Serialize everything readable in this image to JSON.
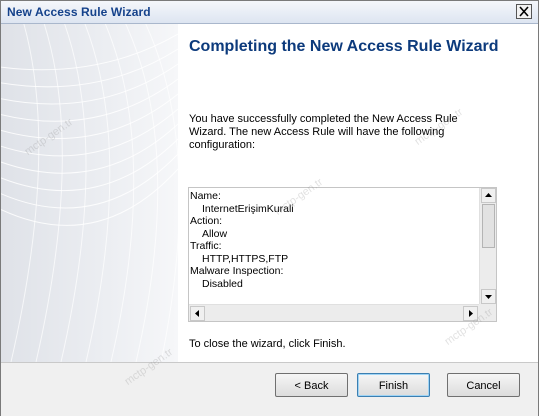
{
  "window": {
    "title": "New Access Rule Wizard",
    "close_glyph": "×"
  },
  "content": {
    "heading": "Completing the New Access Rule Wizard",
    "intro": "You have successfully completed the New Access Rule Wizard. The new Access Rule will have the following configuration:",
    "summary": [
      {
        "label": "Name:",
        "value": "InternetErişimKurali"
      },
      {
        "label": "Action:",
        "value": "Allow"
      },
      {
        "label": "Traffic:",
        "value": "HTTP,HTTPS,FTP"
      },
      {
        "label": "Malware Inspection:",
        "value": "Disabled"
      }
    ],
    "closing": "To close the wizard, click Finish."
  },
  "buttons": {
    "back": "< Back",
    "finish": "Finish",
    "cancel": "Cancel"
  },
  "watermark": "mctp-gen.tr",
  "icons": {
    "close": "close-icon",
    "scroll_up": "arrow-up-icon",
    "scroll_down": "arrow-down-icon",
    "scroll_left": "arrow-left-icon",
    "scroll_right": "arrow-right-icon"
  },
  "colors": {
    "title_text": "#15428b",
    "heading": "#0c3a7c",
    "footer_bg": "#f0f0f0"
  }
}
